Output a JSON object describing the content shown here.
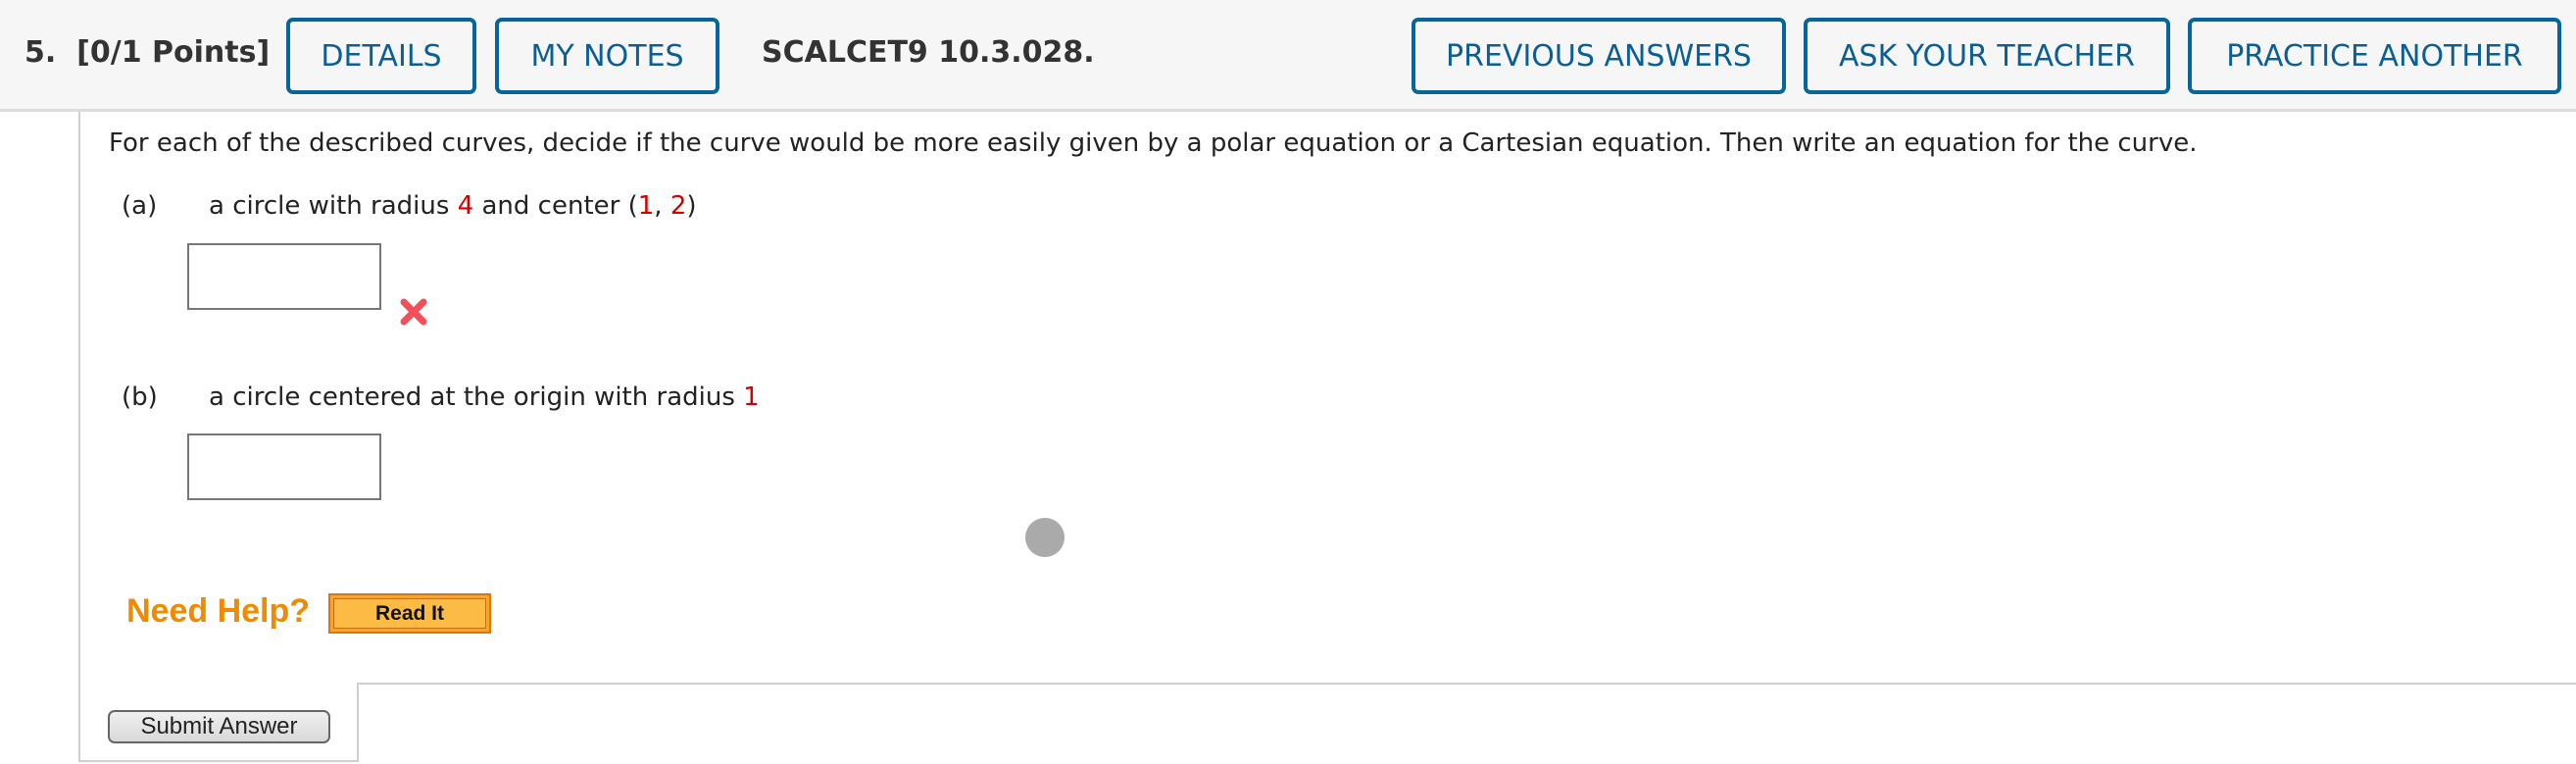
{
  "header": {
    "question_number": "5.",
    "points": "[0/1 Points]",
    "details_label": "DETAILS",
    "my_notes_label": "MY NOTES",
    "problem_code": "SCALCET9 10.3.028.",
    "previous_answers_label": "PREVIOUS ANSWERS",
    "ask_teacher_label": "ASK YOUR TEACHER",
    "practice_another_label": "PRACTICE ANOTHER",
    "button_color": "#06659b"
  },
  "question": {
    "intro": "For each of the described curves, decide if the curve would be more easily given by a polar equation or a Cartesian equation. Then write an equation for the curve.",
    "parts": [
      {
        "label": "(a)",
        "text_before": "a circle with radius ",
        "radius": "4",
        "text_mid": " and center (",
        "cx": "1",
        "comma": ", ",
        "cy": "2",
        "text_end": ")",
        "answer_value": "",
        "status": "incorrect",
        "status_icon": "red-x-icon"
      },
      {
        "label": "(b)",
        "text_before": "a circle centered at the origin with radius ",
        "radius": "1",
        "answer_value": ""
      }
    ],
    "highlight_color": "#d40000"
  },
  "help": {
    "need_help_label": "Need Help?",
    "read_it_label": "Read It"
  },
  "submit_label": "Submit Answer"
}
